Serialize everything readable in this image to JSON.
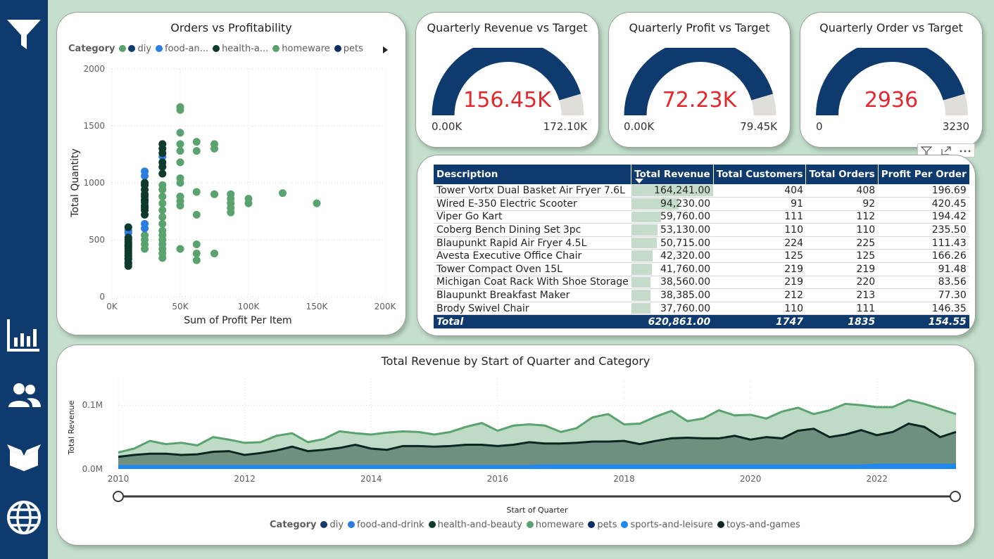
{
  "nav": {
    "icons": [
      "filter-icon",
      "bar-chart-icon",
      "users-icon",
      "box-icon",
      "globe-icon"
    ]
  },
  "colors": {
    "nav": "#0f3a6e",
    "background": "#c5dfcd",
    "gauge_fill": "#0f3a6e",
    "gauge_rest": "#e1ddd9",
    "gauge_value": "#e0282e",
    "diy": "#123a6b",
    "food-and-drink": "#2c7de0",
    "health-and-beauty": "#0d3a2c",
    "homeware": "#5aa36e",
    "pets": "#0b2f5e",
    "sports-and-leisure": "#1e88f0",
    "toys-and-games": "#0a2622"
  },
  "gauges": [
    {
      "title": "Quarterly Revenue vs Target",
      "value": "156.45K",
      "min": "0.00K",
      "max": "172.10K",
      "fraction": 0.909
    },
    {
      "title": "Quarterly Profit vs Target",
      "value": "72.23K",
      "min": "0.00K",
      "max": "79.45K",
      "fraction": 0.909
    },
    {
      "title": "Quarterly Order vs Target",
      "value": "2936",
      "min": "0",
      "max": "3230",
      "fraction": 0.909
    }
  ],
  "table": {
    "columns": [
      "Description",
      "Total Revenue",
      "Total Customers",
      "Total Orders",
      "Profit Per Order"
    ],
    "rows": [
      [
        "Tower Vortx Dual Basket Air Fryer 7.6L",
        "164,241.00",
        "404",
        "408",
        "196.69"
      ],
      [
        "Wired E-350 Electric Scooter",
        "94,230.00",
        "91",
        "92",
        "420.45"
      ],
      [
        "Viper Go Kart",
        "59,760.00",
        "111",
        "112",
        "194.42"
      ],
      [
        "Coberg Bench Dining Set 3pc",
        "53,130.00",
        "110",
        "110",
        "235.50"
      ],
      [
        "Blaupunkt Rapid Air Fryer 4.5L",
        "50,715.00",
        "224",
        "225",
        "111.43"
      ],
      [
        "Avesta Executive Office Chair",
        "42,320.00",
        "125",
        "125",
        "166.26"
      ],
      [
        "Tower Compact Oven 15L",
        "41,760.00",
        "219",
        "219",
        "91.48"
      ],
      [
        "Michigan Coat Rack With Shoe Storage",
        "38,560.00",
        "219",
        "220",
        "83.56"
      ],
      [
        "Blaupunkt Breakfast Maker",
        "38,385.00",
        "212",
        "213",
        "77.30"
      ],
      [
        "Brody Swivel Chair",
        "37,760.00",
        "110",
        "111",
        "146.35"
      ]
    ],
    "revenue_values": [
      164241,
      94230,
      59760,
      53130,
      50715,
      42320,
      41760,
      38560,
      38385,
      37760
    ],
    "total": [
      "Total",
      "620,861.00",
      "1747",
      "1835",
      "154.55"
    ]
  },
  "chart_data": [
    {
      "type": "scatter",
      "title": "Orders vs Profitability",
      "xlabel": "Sum of Profit Per Item",
      "ylabel": "Total Quantity",
      "xlim": [
        0,
        200000
      ],
      "ylim": [
        0,
        2000
      ],
      "x_ticks": [
        "0K",
        "50K",
        "100K",
        "150K",
        "200K"
      ],
      "y_ticks": [
        "0",
        "500",
        "1000",
        "1500",
        "2000"
      ],
      "grid": true,
      "legend": {
        "title": "Category",
        "position": "top",
        "entries": [
          "diy",
          "food-an...",
          "health-a...",
          "homeware",
          "pets"
        ]
      },
      "series": [
        {
          "name": "diy",
          "points": [
            [
              12000,
              290
            ],
            [
              12000,
              340
            ],
            [
              12000,
              380
            ],
            [
              12000,
              420
            ],
            [
              12000,
              460
            ],
            [
              12000,
              500
            ],
            [
              24000,
              830
            ],
            [
              24000,
              880
            ]
          ]
        },
        {
          "name": "food-and-drink",
          "points": [
            [
              12000,
              560
            ],
            [
              12000,
              580
            ],
            [
              24000,
              600
            ],
            [
              24000,
              640
            ],
            [
              24000,
              1060
            ],
            [
              24000,
              1100
            ],
            [
              37000,
              1230
            ]
          ]
        },
        {
          "name": "health-and-beauty",
          "points": [
            [
              12000,
              270
            ],
            [
              12000,
              300
            ],
            [
              12000,
              330
            ],
            [
              12000,
              360
            ],
            [
              12000,
              400
            ],
            [
              12000,
              440
            ],
            [
              12000,
              480
            ],
            [
              12000,
              520
            ],
            [
              12000,
              610
            ],
            [
              24000,
              720
            ],
            [
              24000,
              760
            ],
            [
              24000,
              800
            ],
            [
              24000,
              850
            ],
            [
              24000,
              900
            ],
            [
              24000,
              940
            ],
            [
              24000,
              980
            ],
            [
              37000,
              1080
            ],
            [
              37000,
              1140
            ],
            [
              37000,
              1180
            ],
            [
              37000,
              1260
            ],
            [
              37000,
              1300
            ],
            [
              37000,
              1340
            ],
            [
              24000,
              1000
            ]
          ]
        },
        {
          "name": "homeware",
          "points": [
            [
              12000,
              360
            ],
            [
              24000,
              420
            ],
            [
              24000,
              460
            ],
            [
              24000,
              500
            ],
            [
              24000,
              540
            ],
            [
              37000,
              340
            ],
            [
              37000,
              380
            ],
            [
              37000,
              420
            ],
            [
              37000,
              460
            ],
            [
              37000,
              500
            ],
            [
              37000,
              540
            ],
            [
              37000,
              580
            ],
            [
              37000,
              640
            ],
            [
              37000,
              700
            ],
            [
              37000,
              760
            ],
            [
              37000,
              820
            ],
            [
              37000,
              880
            ],
            [
              37000,
              940
            ],
            [
              37000,
              980
            ],
            [
              50000,
              420
            ],
            [
              50000,
              800
            ],
            [
              50000,
              840
            ],
            [
              50000,
              880
            ],
            [
              50000,
              1000
            ],
            [
              50000,
              1040
            ],
            [
              50000,
              1180
            ],
            [
              50000,
              1280
            ],
            [
              50000,
              1340
            ],
            [
              50000,
              1440
            ],
            [
              50000,
              1640
            ],
            [
              50000,
              1665
            ],
            [
              62000,
              320
            ],
            [
              62000,
              380
            ],
            [
              62000,
              460
            ],
            [
              62000,
              720
            ],
            [
              62000,
              920
            ],
            [
              62000,
              1280
            ],
            [
              62000,
              1360
            ],
            [
              75000,
              380
            ],
            [
              75000,
              900
            ],
            [
              75000,
              1300
            ],
            [
              75000,
              1340
            ],
            [
              87000,
              740
            ],
            [
              87000,
              780
            ],
            [
              87000,
              820
            ],
            [
              87000,
              860
            ],
            [
              87000,
              900
            ],
            [
              100000,
              820
            ],
            [
              100000,
              860
            ],
            [
              125000,
              910
            ],
            [
              150000,
              820
            ]
          ]
        },
        {
          "name": "pets",
          "points": [
            [
              12000,
              450
            ],
            [
              24000,
              780
            ]
          ]
        }
      ]
    },
    {
      "type": "area",
      "title": "Total Revenue by Start of Quarter and Category",
      "xlabel": "Start of Quarter",
      "ylabel": "Total Revenue",
      "xlim": [
        2010,
        2023.25
      ],
      "ylim": [
        0,
        0.13
      ],
      "y_ticks": [
        "0.0M",
        "0.1M"
      ],
      "x_ticks": [
        "2010",
        "2012",
        "2014",
        "2016",
        "2018",
        "2020",
        "2022"
      ],
      "y_unit": "M",
      "grid": true,
      "legend": {
        "title": "Category",
        "position": "bottom",
        "entries": [
          "diy",
          "food-and-drink",
          "health-and-beauty",
          "homeware",
          "pets",
          "sports-and-leisure",
          "toys-and-games"
        ]
      },
      "x": [
        2010,
        2010.25,
        2010.5,
        2010.75,
        2011,
        2011.25,
        2011.5,
        2011.75,
        2012,
        2012.25,
        2012.5,
        2012.75,
        2013,
        2013.25,
        2013.5,
        2013.75,
        2014,
        2014.25,
        2014.5,
        2014.75,
        2015,
        2015.25,
        2015.5,
        2015.75,
        2016,
        2016.25,
        2016.5,
        2016.75,
        2017,
        2017.25,
        2017.5,
        2017.75,
        2018,
        2018.25,
        2018.5,
        2018.75,
        2019,
        2019.25,
        2019.5,
        2019.75,
        2020,
        2020.25,
        2020.5,
        2020.75,
        2021,
        2021.25,
        2021.5,
        2021.75,
        2022,
        2022.25,
        2022.5,
        2022.75,
        2023,
        2023.25
      ],
      "series": [
        {
          "name": "homeware",
          "values": [
            0.026,
            0.032,
            0.044,
            0.039,
            0.041,
            0.037,
            0.05,
            0.046,
            0.041,
            0.042,
            0.052,
            0.056,
            0.042,
            0.047,
            0.059,
            0.056,
            0.054,
            0.057,
            0.059,
            0.058,
            0.054,
            0.058,
            0.066,
            0.072,
            0.06,
            0.068,
            0.07,
            0.068,
            0.058,
            0.064,
            0.081,
            0.086,
            0.07,
            0.071,
            0.082,
            0.091,
            0.075,
            0.079,
            0.092,
            0.084,
            0.085,
            0.079,
            0.09,
            0.096,
            0.086,
            0.092,
            0.102,
            0.1,
            0.097,
            0.097,
            0.108,
            0.102,
            0.094,
            0.086
          ]
        },
        {
          "name": "toys-and-games",
          "values": [
            0.019,
            0.022,
            0.024,
            0.024,
            0.022,
            0.023,
            0.027,
            0.028,
            0.022,
            0.025,
            0.029,
            0.035,
            0.028,
            0.03,
            0.033,
            0.038,
            0.032,
            0.03,
            0.036,
            0.036,
            0.035,
            0.036,
            0.038,
            0.038,
            0.036,
            0.038,
            0.042,
            0.04,
            0.04,
            0.041,
            0.043,
            0.043,
            0.044,
            0.039,
            0.044,
            0.048,
            0.049,
            0.048,
            0.048,
            0.052,
            0.046,
            0.05,
            0.048,
            0.06,
            0.063,
            0.05,
            0.054,
            0.061,
            0.053,
            0.058,
            0.071,
            0.066,
            0.05,
            0.058
          ]
        },
        {
          "name": "sports-and-leisure",
          "values": [
            0.004,
            0.004,
            0.004,
            0.004,
            0.004,
            0.004,
            0.004,
            0.004,
            0.004,
            0.004,
            0.004,
            0.004,
            0.004,
            0.004,
            0.004,
            0.004,
            0.004,
            0.004,
            0.004,
            0.004,
            0.004,
            0.004,
            0.004,
            0.004,
            0.004,
            0.004,
            0.004,
            0.005,
            0.005,
            0.005,
            0.005,
            0.005,
            0.005,
            0.005,
            0.005,
            0.005,
            0.005,
            0.005,
            0.005,
            0.005,
            0.005,
            0.005,
            0.005,
            0.005,
            0.005,
            0.005,
            0.005,
            0.005,
            0.006,
            0.006,
            0.006,
            0.006,
            0.006,
            0.006
          ]
        }
      ]
    }
  ],
  "toolbar": {
    "icons": [
      "filter-icon",
      "focus-mode-icon",
      "more-options-icon"
    ]
  },
  "slider": {
    "label": "Start of Quarter"
  }
}
